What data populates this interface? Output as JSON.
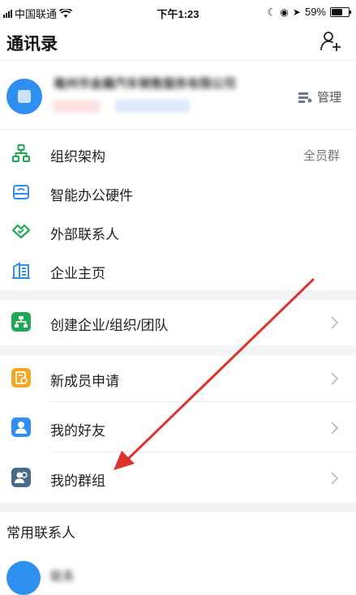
{
  "status_bar": {
    "carrier": "中国联通",
    "time": "下午1:23",
    "battery": "59%",
    "battery_level": 0.59
  },
  "header": {
    "title": "通讯录",
    "add_icon": "add-contact-icon"
  },
  "org_card": {
    "name": "亳州市金撬汽车销售服务有限公司",
    "tag_unverified": "未认证",
    "tag_other": "去认证",
    "manage_label": "管理"
  },
  "org_menu": [
    {
      "icon": "org-structure-icon",
      "label": "组织架构",
      "right_text": "全员群"
    },
    {
      "icon": "smart-hardware-icon",
      "label": "智能办公硬件"
    },
    {
      "icon": "external-contacts-icon",
      "label": "外部联系人"
    },
    {
      "icon": "company-home-icon",
      "label": "企业主页"
    }
  ],
  "create": {
    "icon": "create-team-icon",
    "label": "创建企业/组织/团队"
  },
  "social_menu": [
    {
      "icon": "new-member-icon",
      "label": "新成员申请"
    },
    {
      "icon": "friends-icon",
      "label": "我的好友"
    },
    {
      "icon": "groups-icon",
      "label": "我的群组"
    }
  ],
  "frequent": {
    "title": "常用联系人",
    "contact_name": "联系"
  },
  "colors": {
    "accent": "#2e8ff0",
    "green": "#1fa855",
    "orange": "#f5a623",
    "slate": "#4a6a8a",
    "annotation_arrow": "#e0322c"
  }
}
